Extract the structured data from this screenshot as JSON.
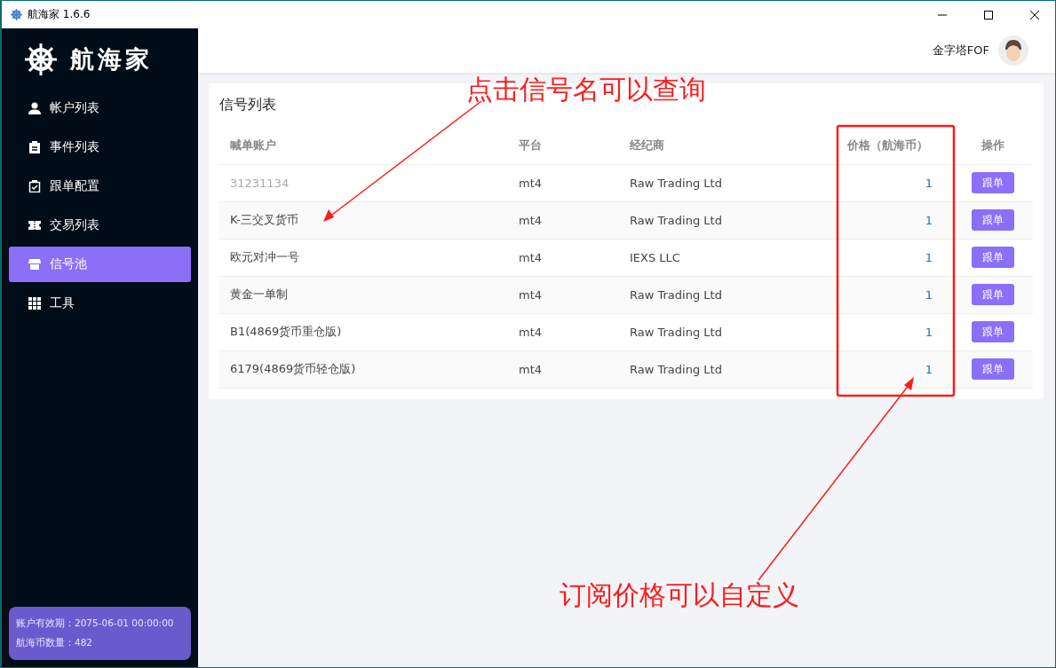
{
  "window": {
    "title": "航海家 1.6.6"
  },
  "sidebar": {
    "logo": "航海家",
    "items": [
      {
        "label": "帐户列表",
        "selected": false
      },
      {
        "label": "事件列表",
        "selected": false
      },
      {
        "label": "跟单配置",
        "selected": false
      },
      {
        "label": "交易列表",
        "selected": false
      },
      {
        "label": "信号池",
        "selected": true
      },
      {
        "label": "工具",
        "selected": false
      }
    ],
    "info": [
      "账户有效期：2075-06-01 00:00:00",
      "航海币数量：482"
    ]
  },
  "header": {
    "user": "金字塔FOF"
  },
  "panel": {
    "title": "信号列表",
    "columns": [
      "喊单账户",
      "平台",
      "经纪商",
      "价格（航海币）",
      "操作"
    ],
    "rows": [
      {
        "name": "31231134",
        "platform": "mt4",
        "broker": "Raw Trading Ltd",
        "price": "1",
        "action": "跟单",
        "muted": true
      },
      {
        "name": "K-三交叉货币",
        "platform": "mt4",
        "broker": "Raw Trading Ltd",
        "price": "1",
        "action": "跟单",
        "muted": false
      },
      {
        "name": "欧元对冲一号",
        "platform": "mt4",
        "broker": "IEXS LLC",
        "price": "1",
        "action": "跟单",
        "muted": false
      },
      {
        "name": "黄金一单制",
        "platform": "mt4",
        "broker": "Raw Trading Ltd",
        "price": "1",
        "action": "跟单",
        "muted": false
      },
      {
        "name": "B1(4869货币重仓版)",
        "platform": "mt4",
        "broker": "Raw Trading Ltd",
        "price": "1",
        "action": "跟单",
        "muted": false
      },
      {
        "name": "6179(4869货币轻仓版)",
        "platform": "mt4",
        "broker": "Raw Trading Ltd",
        "price": "1",
        "action": "跟单",
        "muted": false
      }
    ]
  },
  "annotations": [
    "点击信号名可以查询",
    "订阅价格可以自定义"
  ]
}
